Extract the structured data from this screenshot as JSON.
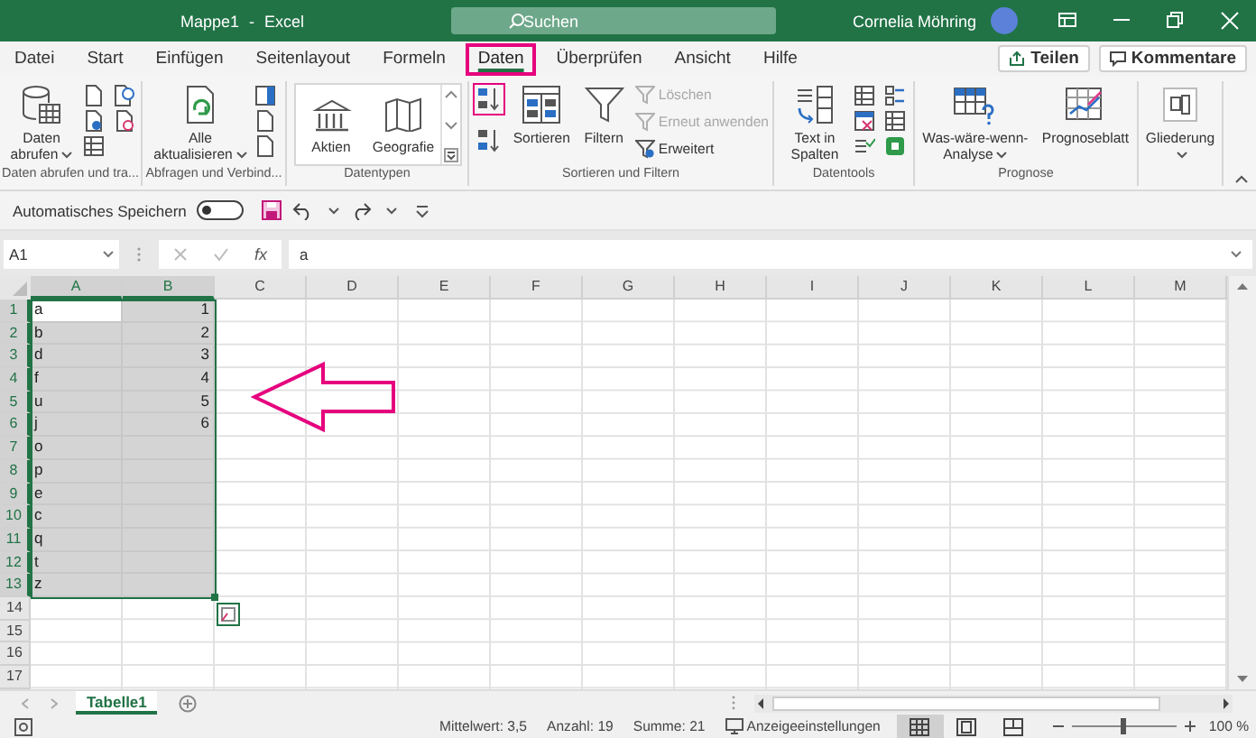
{
  "window": {
    "title": "Mappe1 - Excel",
    "search_placeholder": "Suchen",
    "user": "Cornelia Möhring"
  },
  "tabs": [
    {
      "label": "Datei",
      "selected": false,
      "highlighted": false
    },
    {
      "label": "Start",
      "selected": false,
      "highlighted": false
    },
    {
      "label": "Einfügen",
      "selected": false,
      "highlighted": false
    },
    {
      "label": "Seitenlayout",
      "selected": false,
      "highlighted": false
    },
    {
      "label": "Formeln",
      "selected": false,
      "highlighted": false
    },
    {
      "label": "Daten",
      "selected": true,
      "highlighted": true
    },
    {
      "label": "Überprüfen",
      "selected": false,
      "highlighted": false
    },
    {
      "label": "Ansicht",
      "selected": false,
      "highlighted": false
    },
    {
      "label": "Hilfe",
      "selected": false,
      "highlighted": false
    }
  ],
  "share_button": "Teilen",
  "comments_button": "Kommentare",
  "ribbon": {
    "groups": [
      {
        "label": "Daten abrufen und tra...",
        "items": [
          {
            "kind": "large",
            "label": "Daten abrufen",
            "dropdown": true
          },
          {
            "kind": "icons"
          }
        ]
      },
      {
        "label": "Abfragen und Verbind...",
        "items": [
          {
            "kind": "large",
            "label": "Alle aktualisieren",
            "dropdown": true
          },
          {
            "kind": "icons"
          }
        ]
      },
      {
        "label": "Datentypen",
        "items": [
          {
            "kind": "gallery",
            "options": [
              {
                "label": "Aktien"
              },
              {
                "label": "Geografie"
              }
            ]
          }
        ]
      },
      {
        "label": "Sortieren und Filtern",
        "items": [
          {
            "kind": "sort",
            "highlighted": true
          },
          {
            "kind": "large",
            "label": "Sortieren",
            "dropdown": false
          },
          {
            "kind": "large",
            "label": "Filtern",
            "dropdown": false
          },
          {
            "kind": "list",
            "entries": [
              {
                "label": "Löschen",
                "disabled": true
              },
              {
                "label": "Erneut anwenden",
                "disabled": true
              },
              {
                "label": "Erweitert",
                "disabled": false
              }
            ]
          }
        ]
      },
      {
        "label": "Datentools",
        "items": [
          {
            "kind": "large",
            "label": "Text in Spalten",
            "dropdown": false
          },
          {
            "kind": "icons"
          }
        ]
      },
      {
        "label": "Prognose",
        "items": [
          {
            "kind": "large",
            "label": "Was-wäre-wenn-Analyse",
            "dropdown": true
          },
          {
            "kind": "large",
            "label": "Prognoseblatt",
            "dropdown": false
          }
        ]
      },
      {
        "items": [
          {
            "kind": "large",
            "label": "Gliederung",
            "dropdown": true
          }
        ]
      }
    ]
  },
  "quick_access": {
    "autosave_label": "Automatisches Speichern",
    "autosave_on": false
  },
  "formula_bar": {
    "name_box": "A1",
    "insert_function": "fx",
    "formula": "a"
  },
  "grid": {
    "columns": [
      {
        "label": "A",
        "selected": true
      },
      {
        "label": "B",
        "selected": true
      },
      {
        "label": "C",
        "selected": false
      },
      {
        "label": "D",
        "selected": false
      },
      {
        "label": "E",
        "selected": false
      },
      {
        "label": "F",
        "selected": false
      },
      {
        "label": "G",
        "selected": false
      },
      {
        "label": "H",
        "selected": false
      },
      {
        "label": "I",
        "selected": false
      },
      {
        "label": "J",
        "selected": false
      },
      {
        "label": "K",
        "selected": false
      },
      {
        "label": "L",
        "selected": false
      },
      {
        "label": "M",
        "selected": false
      }
    ],
    "rows": [
      {
        "number": "1",
        "cells": [
          "a",
          "1"
        ],
        "selected": true,
        "active": true
      },
      {
        "number": "2",
        "cells": [
          "b",
          "2"
        ],
        "selected": true,
        "active": false
      },
      {
        "number": "3",
        "cells": [
          "d",
          "3"
        ],
        "selected": true,
        "active": false
      },
      {
        "number": "4",
        "cells": [
          "f",
          "4"
        ],
        "selected": true,
        "active": false
      },
      {
        "number": "5",
        "cells": [
          "u",
          "5"
        ],
        "selected": true,
        "active": false
      },
      {
        "number": "6",
        "cells": [
          "j",
          "6"
        ],
        "selected": true,
        "active": false
      },
      {
        "number": "7",
        "cells": [
          "o"
        ],
        "selected": true,
        "active": false
      },
      {
        "number": "8",
        "cells": [
          "p"
        ],
        "selected": true,
        "active": false
      },
      {
        "number": "9",
        "cells": [
          "e"
        ],
        "selected": true,
        "active": false
      },
      {
        "number": "10",
        "cells": [
          "c"
        ],
        "selected": true,
        "active": false
      },
      {
        "number": "11",
        "cells": [
          "q"
        ],
        "selected": true,
        "active": false
      },
      {
        "number": "12",
        "cells": [
          "t"
        ],
        "selected": true,
        "active": false
      },
      {
        "number": "13",
        "cells": [
          "z"
        ],
        "selected": true,
        "active": false
      },
      {
        "number": "14",
        "selected": false,
        "active": false
      },
      {
        "number": "15",
        "selected": false,
        "active": false
      },
      {
        "number": "16",
        "selected": false,
        "active": false
      },
      {
        "number": "17",
        "selected": false,
        "active": false
      }
    ]
  },
  "annotation": {
    "kind": "arrow"
  },
  "sheets": [
    {
      "label": "Tabelle1",
      "selected": true
    }
  ],
  "status_bar": {
    "average": "Mittelwert: 3,5",
    "count": "Anzahl: 19",
    "sum": "Summe: 21",
    "display_settings": "Anzeigeeinstellungen",
    "views": [
      {
        "selected": true
      },
      {
        "selected": false
      },
      {
        "selected": false
      }
    ],
    "zoom": {
      "level": 0.5,
      "reading": "100 %"
    }
  }
}
